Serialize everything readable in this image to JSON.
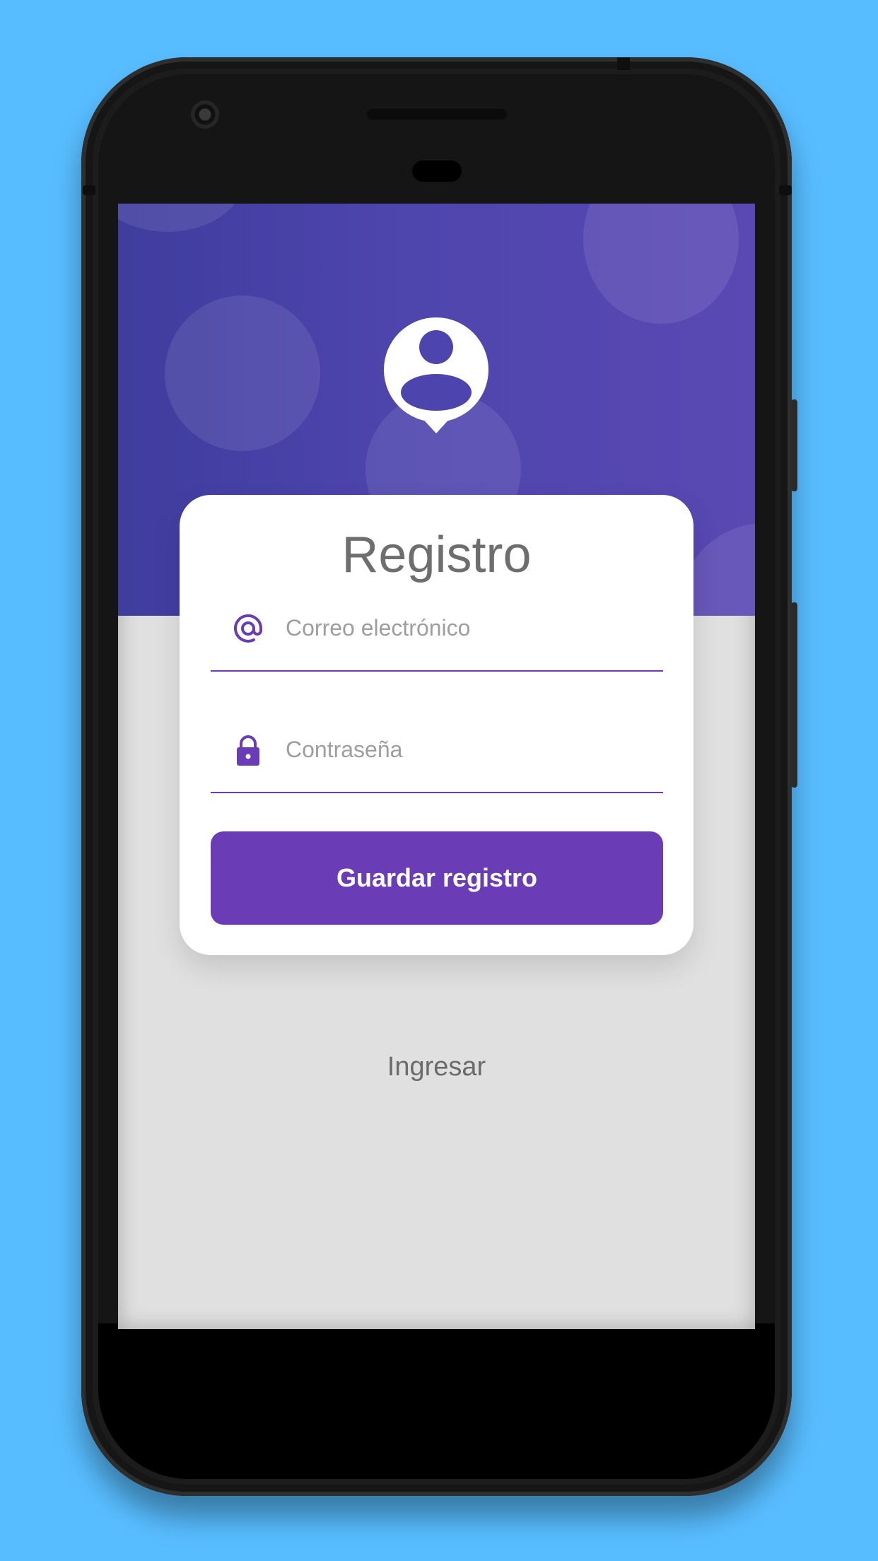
{
  "colors": {
    "background": "#58bdff",
    "header_gradient_start": "#3f3d9e",
    "header_gradient_end": "#5a48b3",
    "accent": "#6a3db7",
    "screen_background": "#e0e0e0",
    "card": "#ffffff",
    "title_text": "#6e6e6e"
  },
  "header": {
    "avatar_icon": "user-pin-icon"
  },
  "card": {
    "title": "Registro",
    "email": {
      "icon": "at-sign-icon",
      "placeholder": "Correo electrónico",
      "value": ""
    },
    "password": {
      "icon": "lock-icon",
      "placeholder": "Contraseña",
      "value": ""
    },
    "save_label": "Guardar registro"
  },
  "footer": {
    "login_label": "Ingresar"
  }
}
